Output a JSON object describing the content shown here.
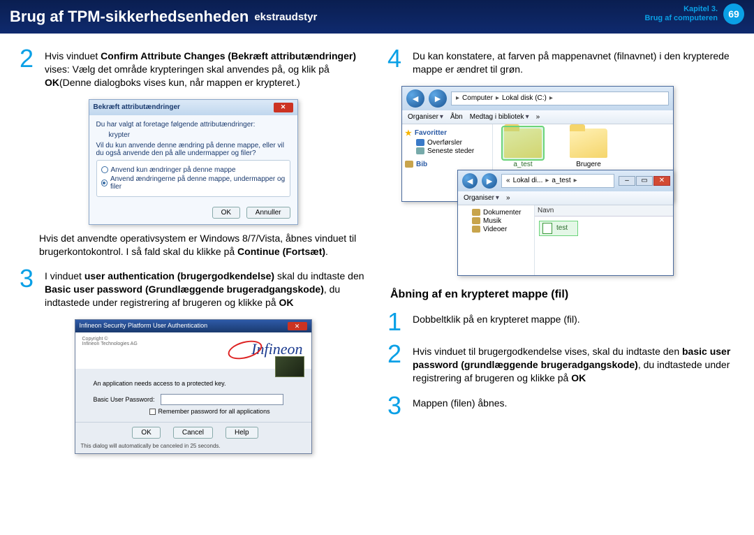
{
  "header": {
    "title": "Brug af TPM-sikkerhedsenheden",
    "subtitle": "ekstraudstyr",
    "chapter_line1": "Kapitel 3.",
    "chapter_line2": "Brug af computeren",
    "page": "69"
  },
  "left": {
    "step2_num": "2",
    "step2_a": "Hvis vinduet ",
    "step2_b": "Confirm Attribute Changes (Bekræft attributændringer)",
    "step2_c": " vises: Vælg det område krypteringen skal anvendes på, og klik på ",
    "step2_d": "OK",
    "step2_e": "(Denne dialogboks vises kun, når mappen er krypteret.)",
    "dlg1": {
      "title": "Bekræft attributændringer",
      "line1": "Du har valgt at foretage følgende attributændringer:",
      "line2": "krypter",
      "line3": "Vil du kun anvende denne ændring på denne mappe, eller vil du også anvende den på alle undermapper og filer?",
      "opt1": "Anvend kun ændringer på denne mappe",
      "opt2": "Anvend ændringerne på denne mappe, undermapper og filer",
      "ok": "OK",
      "cancel": "Annuller"
    },
    "note_a": "Hvis det anvendte operativsystem er Windows 8/7/Vista, åbnes vinduet til brugerkontokontrol. I så fald skal du klikke på ",
    "note_b": "Continue (Fortsæt)",
    "note_c": ".",
    "step3_num": "3",
    "step3_a": "I vinduet ",
    "step3_b": "user authentication (brugergodkendelse)",
    "step3_c": " skal du indtaste den ",
    "step3_d": "Basic user password (Grundlæggende brugeradgangskode)",
    "step3_e": ", du indtastede under registrering af brugeren og klikke på ",
    "step3_f": "OK",
    "dlg2": {
      "title": "Infineon Security Platform User Authentication",
      "logo": "Infineon",
      "copy1": "Copyright ©",
      "copy2": "Infineon Technologies AG",
      "need": "An application needs access to a protected key.",
      "pw_label": "Basic User Password:",
      "remember": "Remember password for all applications",
      "ok": "OK",
      "cancel": "Cancel",
      "help": "Help",
      "autoclose": "This dialog will automatically be canceled in 25 seconds."
    }
  },
  "right": {
    "step4_num": "4",
    "step4_a": "Du kan konstatere, at farven på mappenavnet (filnavnet) i den krypterede mappe er ændret til grøn.",
    "explorer1": {
      "addr_pre": "Computer",
      "addr_seg": "Lokal disk (C:)",
      "tb_org": "Organiser",
      "tb_open": "Åbn",
      "tb_lib": "Medtag i bibliotek",
      "tb_more": "»",
      "fav": "Favoritter",
      "dl": "Overførsler",
      "recent": "Seneste steder",
      "lib": "Bib",
      "folder_a": "a_test",
      "folder_b": "Brugere"
    },
    "explorer2": {
      "addr_a": "«",
      "addr_b": "Lokal di...",
      "addr_c": "a_test",
      "tb_org": "Organiser",
      "tb_more": "»",
      "side_docs": "Dokumenter",
      "side_music": "Musik",
      "side_video": "Videoer",
      "col_name": "Navn",
      "file": "test"
    },
    "section_title": "Åbning af en krypteret mappe (fil)",
    "b_step1_num": "1",
    "b_step1": "Dobbeltklik på en krypteret mappe (fil).",
    "b_step2_num": "2",
    "b_step2_a": "Hvis vinduet til brugergodkendelse vises, skal du indtaste den ",
    "b_step2_b": "basic user password (grundlæggende brugeradgangskode)",
    "b_step2_c": ", du indtastede under registrering af brugeren og klikke på ",
    "b_step2_d": "OK",
    "b_step3_num": "3",
    "b_step3": "Mappen (filen) åbnes."
  }
}
